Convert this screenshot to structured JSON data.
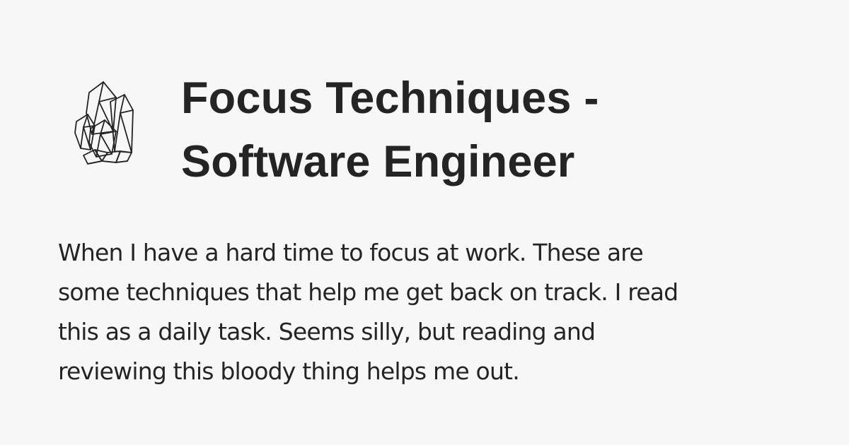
{
  "page": {
    "title_lines": [
      "Focus Techniques -",
      "Software Engineer"
    ],
    "description_lines": [
      "When I have a hard time to focus at work. These are",
      "some techniques that help me get back on track. I read",
      "this as a daily task. Seems silly, but reading and",
      "reviewing this bloody thing helps me out."
    ],
    "icon": "crystal-icon"
  },
  "colors": {
    "background": "#f8f7f8",
    "text": "#242424"
  }
}
